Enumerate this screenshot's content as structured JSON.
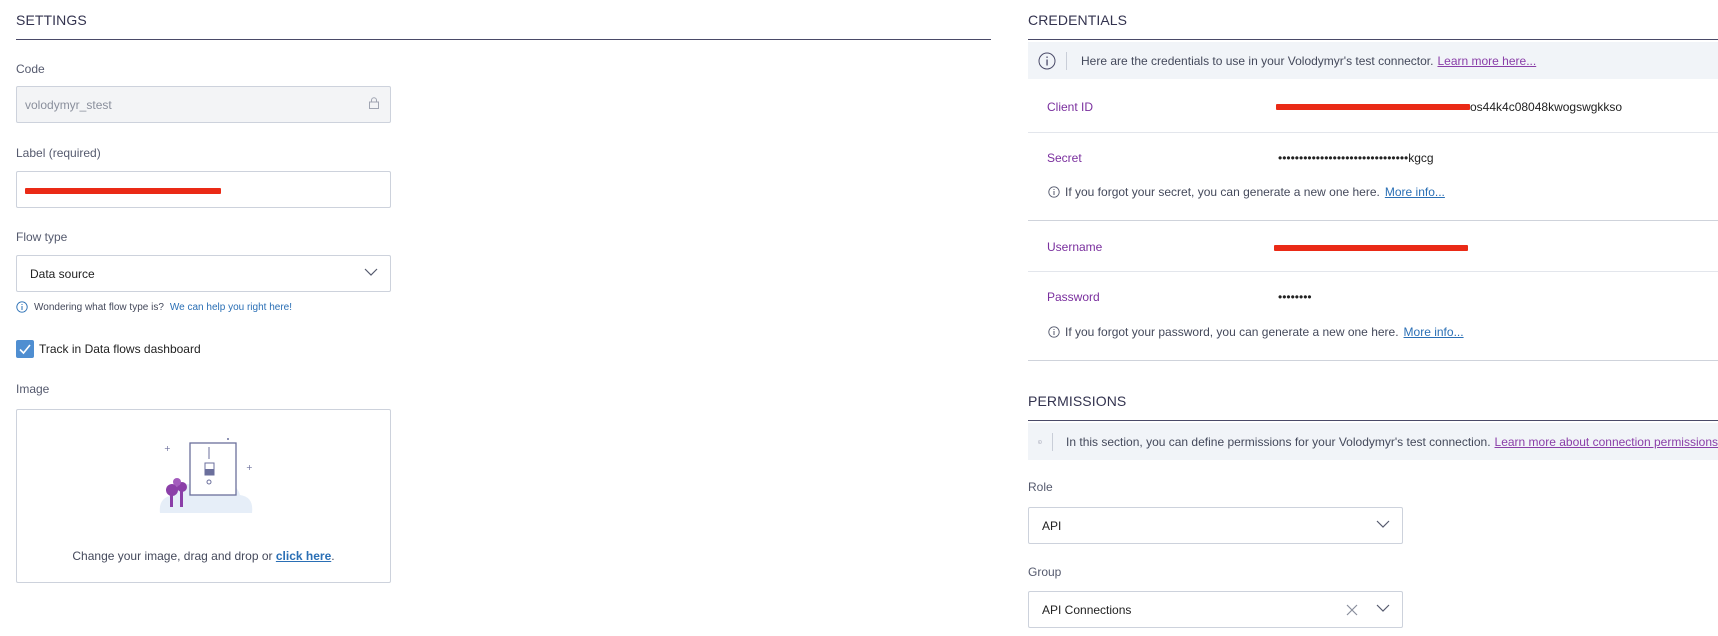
{
  "settings": {
    "title": "SETTINGS",
    "code": {
      "label": "Code",
      "value": "volodymyr_stest"
    },
    "label_field": {
      "label": "Label (required)"
    },
    "flow_type": {
      "label": "Flow type",
      "value": "Data source",
      "hint": "Wondering what flow type is?",
      "hint_link": "We can help you right here!"
    },
    "track": {
      "label": "Track in Data flows dashboard",
      "checked": true
    },
    "image": {
      "label": "Image",
      "text": "Change your image, drag and drop or",
      "link": "click here",
      "suffix": "."
    }
  },
  "credentials": {
    "title": "CREDENTIALS",
    "banner_text": "Here are the credentials to use in your Volodymyr's test connector.",
    "banner_link": "Learn more here...",
    "client_id": {
      "label": "Client ID",
      "value_visible": "os44k4c08048kwogswgkkso"
    },
    "secret": {
      "label": "Secret",
      "value": "•••••••••••••••••••••••••••••••kgcg",
      "hint": "If you forgot your secret, you can generate a new one here.",
      "hint_link": "More info..."
    },
    "username": {
      "label": "Username"
    },
    "password": {
      "label": "Password",
      "value": "••••••••",
      "hint": "If you forgot your password, you can generate a new one here.",
      "hint_link": "More info..."
    }
  },
  "permissions": {
    "title": "PERMISSIONS",
    "banner_text": "In this section, you can define permissions for your Volodymyr's test connection.",
    "banner_link": "Learn more about connection permissions",
    "role": {
      "label": "Role",
      "value": "API"
    },
    "group": {
      "label": "Group",
      "value": "API Connections"
    }
  },
  "colors": {
    "accent": "#4f8ed1",
    "link": "#2a6fb5",
    "label_purple": "#7a2f9e",
    "redaction": "#ea2a16"
  }
}
